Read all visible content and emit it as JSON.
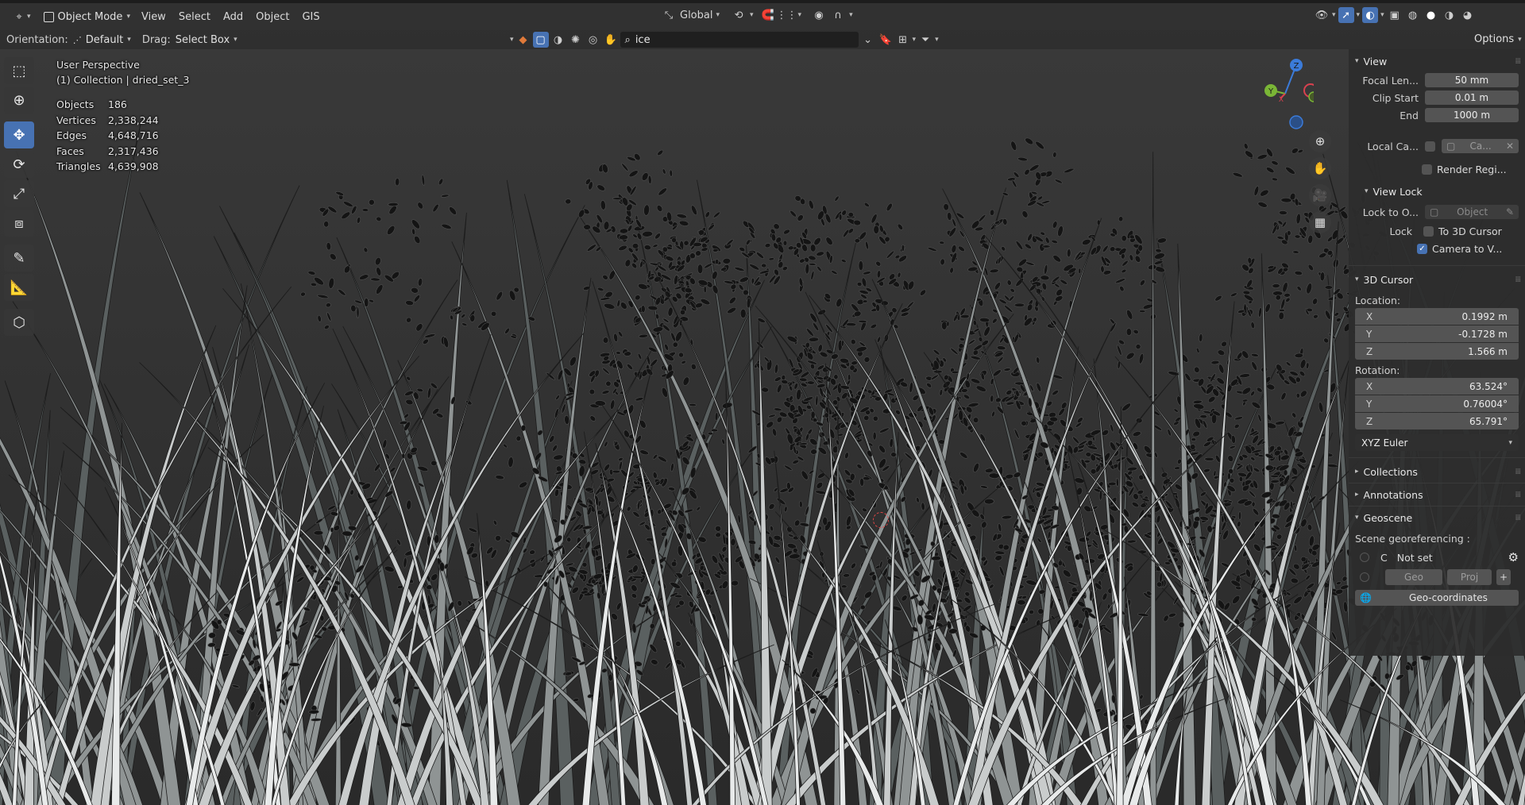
{
  "header": {
    "mode_label": "Object Mode",
    "menus": [
      "View",
      "Select",
      "Add",
      "Object",
      "GIS"
    ],
    "transform_orientation": "Global",
    "options_label": "Options"
  },
  "toolheader": {
    "orientation_label": "Orientation:",
    "orientation_value": "Default",
    "drag_label": "Drag:",
    "drag_value": "Select Box",
    "search_value": "ice"
  },
  "overlay": {
    "view_name": "User Perspective",
    "collection_info": "(1) Collection | dried_set_3",
    "stats": [
      {
        "label": "Objects",
        "value": "186"
      },
      {
        "label": "Vertices",
        "value": "2,338,244"
      },
      {
        "label": "Edges",
        "value": "4,648,716"
      },
      {
        "label": "Faces",
        "value": "2,317,436"
      },
      {
        "label": "Triangles",
        "value": "4,639,908"
      }
    ]
  },
  "gizmo": {
    "x": "X",
    "y": "Y",
    "z": "Z"
  },
  "npanel": {
    "view": {
      "title": "View",
      "focal_label": "Focal Len...",
      "focal_value": "50 mm",
      "clip_start_label": "Clip Start",
      "clip_start_value": "0.01 m",
      "clip_end_label": "End",
      "clip_end_value": "1000 m",
      "local_camera_label": "Local Ca...",
      "local_camera_value": "Ca...",
      "render_region_label": "Render Regi..."
    },
    "view_lock": {
      "title": "View Lock",
      "lock_to_label": "Lock to O...",
      "lock_to_placeholder": "Object",
      "lock_label": "Lock",
      "to_cursor_label": "To 3D Cursor",
      "camera_to_view_label": "Camera to V...",
      "camera_to_view_checked": true
    },
    "cursor": {
      "title": "3D Cursor",
      "location_label": "Location:",
      "location": [
        {
          "axis": "X",
          "value": "0.1992 m"
        },
        {
          "axis": "Y",
          "value": "-0.1728 m"
        },
        {
          "axis": "Z",
          "value": "1.566 m"
        }
      ],
      "rotation_label": "Rotation:",
      "rotation": [
        {
          "axis": "X",
          "value": "63.524°"
        },
        {
          "axis": "Y",
          "value": "0.76004°"
        },
        {
          "axis": "Z",
          "value": "65.791°"
        }
      ],
      "rotation_mode": "XYZ Euler"
    },
    "collections_title": "Collections",
    "annotations_title": "Annotations",
    "geoscene": {
      "title": "Geoscene",
      "georef_label": "Scene georeferencing :",
      "crs_letter": "C",
      "crs_value": "Not set",
      "geo_label": "Geo",
      "proj_label": "Proj",
      "geocoords_label": "Geo-coordinates"
    }
  },
  "colors": {
    "accent": "#4772b3",
    "axis_x": "#d9414f",
    "axis_y": "#7ab636",
    "axis_z": "#3b7bd9"
  }
}
